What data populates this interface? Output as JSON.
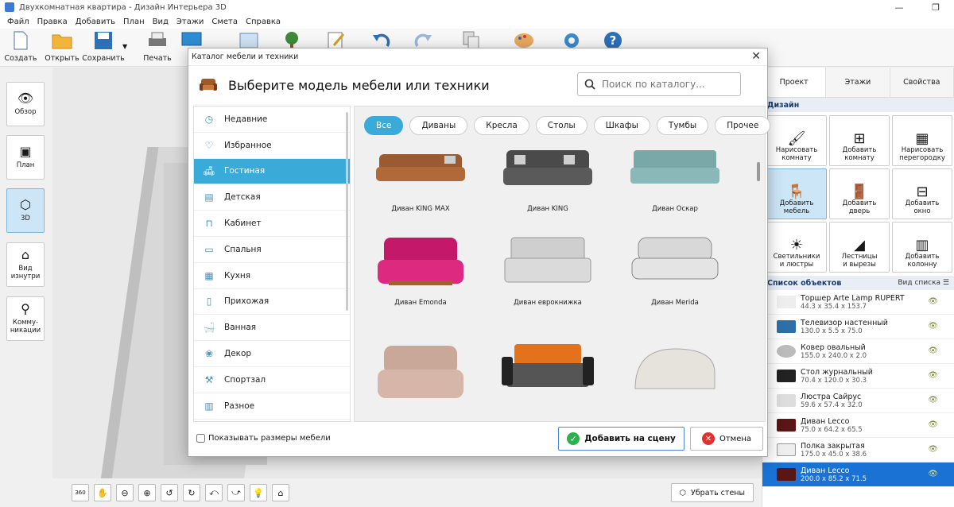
{
  "window": {
    "title": "Двухкомнатная квартира - Дизайн Интерьера 3D",
    "minimize": "—",
    "maximize": "❐"
  },
  "menu": [
    "Файл",
    "Правка",
    "Добавить",
    "План",
    "Вид",
    "Этажи",
    "Смета",
    "Справка"
  ],
  "toolbar": {
    "create": "Создать",
    "open": "Открыть",
    "save": "Сохранить",
    "print": "Печать",
    "p_cut": "П"
  },
  "left_panel": {
    "overview": "Обзор",
    "plan": "План",
    "three_d": "3D",
    "inside_line1": "Вид",
    "inside_line2": "изнутри",
    "comm_line1": "Комму-",
    "comm_line2": "никации"
  },
  "bottom_bar": {
    "remove_walls": "Убрать стены",
    "rotate_360": "360"
  },
  "right_panel": {
    "tabs": [
      "Проект",
      "Этажи",
      "Свойства"
    ],
    "design_header": "Дизайн",
    "design_tools": [
      {
        "l1": "Нарисовать",
        "l2": "комнату"
      },
      {
        "l1": "Добавить",
        "l2": "комнату"
      },
      {
        "l1": "Нарисовать",
        "l2": "перегородку"
      },
      {
        "l1": "Добавить",
        "l2": "мебель"
      },
      {
        "l1": "Добавить",
        "l2": "дверь"
      },
      {
        "l1": "Добавить",
        "l2": "окно"
      },
      {
        "l1": "Светильники",
        "l2": "и люстры"
      },
      {
        "l1": "Лестницы",
        "l2": "и вырезы"
      },
      {
        "l1": "Добавить",
        "l2": "колонну"
      }
    ],
    "objects_header": "Список объектов",
    "list_view": "Вид списка",
    "objects": [
      {
        "name": "Торшер Arte Lamp RUPERT",
        "size": "44.3 x 35.4 x 153.7"
      },
      {
        "name": "Телевизор настенный",
        "size": "130.0 x 5.5 x 75.0"
      },
      {
        "name": "Ковер овальный",
        "size": "155.0 x 240.0 x 2.0"
      },
      {
        "name": "Стол журнальный",
        "size": "70.4 x 120.0 x 30.3"
      },
      {
        "name": "Люстра Сайрус",
        "size": "59.6 x 57.4 x 32.0"
      },
      {
        "name": "Диван Lecco",
        "size": "75.0 x 64.2 x 65.5"
      },
      {
        "name": "Полка закрытая",
        "size": "175.0 x 45.0 x 38.6"
      },
      {
        "name": "Диван Lecco",
        "size": "200.0 x 85.2 x 71.5"
      }
    ]
  },
  "dialog": {
    "title": "Каталог мебели и техники",
    "heading": "Выберите модель мебели или техники",
    "search_placeholder": "Поиск по каталогу...",
    "categories": [
      "Недавние",
      "Избранное",
      "Гостиная",
      "Детская",
      "Кабинет",
      "Спальня",
      "Кухня",
      "Прихожая",
      "Ванная",
      "Декор",
      "Спортзал",
      "Разное"
    ],
    "filters": [
      "Все",
      "Диваны",
      "Кресла",
      "Столы",
      "Шкафы",
      "Тумбы",
      "Прочее"
    ],
    "items": [
      "Диван KING MAX",
      "Диван KING",
      "Диван Оскар",
      "Диван Emonda",
      "Диван еврокнижка",
      "Диван Merida",
      "",
      "",
      ""
    ],
    "show_sizes": "Показывать размеры мебели",
    "add_button": "Добавить на сцену",
    "cancel_button": "Отмена"
  },
  "colors": {
    "accent": "#3aabd9",
    "selection": "#1a73d4",
    "ok": "#2bb24c",
    "cancel": "#e03030"
  }
}
